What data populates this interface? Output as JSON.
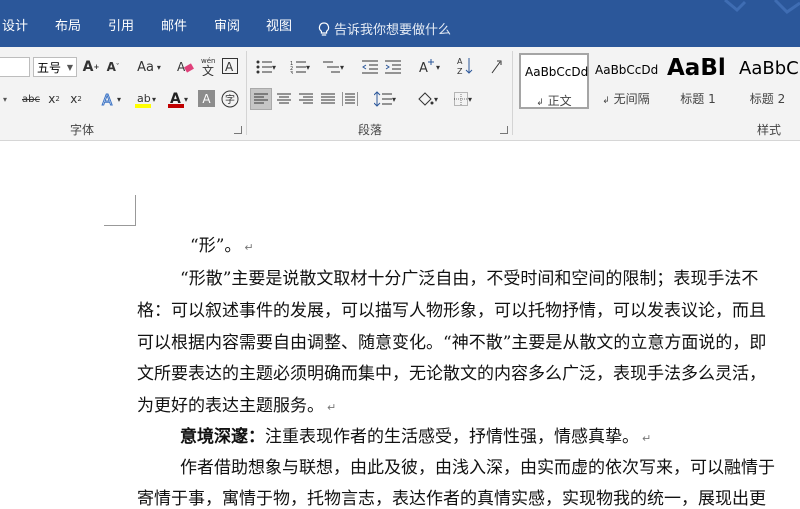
{
  "tabs": [
    {
      "label": "设计"
    },
    {
      "label": "布局"
    },
    {
      "label": "引用"
    },
    {
      "label": "邮件"
    },
    {
      "label": "审阅"
    },
    {
      "label": "视图"
    }
  ],
  "tell_me": {
    "placeholder": "告诉我你想要做什么"
  },
  "font": {
    "size": "五号"
  },
  "groups": {
    "font_label": "字体",
    "paragraph_label": "段落",
    "styles_label": "样式"
  },
  "styles": [
    {
      "preview": "AaBbCcDd",
      "name": "正文",
      "selected": true
    },
    {
      "preview": "AaBbCcDd",
      "name": "无间隔"
    },
    {
      "preview": "AaBl",
      "name": "标题 1"
    },
    {
      "preview": "AaBbC",
      "name": "标题 2"
    }
  ],
  "document": {
    "lines": [
      {
        "text": "“形”。",
        "mark": "↵"
      },
      {
        "text": "“形散”主要是说散文取材十分广泛自由，不受时间和空间的限制；表现手法不"
      },
      {
        "text": "格：可以叙述事件的发展，可以描写人物形象，可以托物抒情，可以发表议论，而且"
      },
      {
        "text": "可以根据内容需要自由调整、随意变化。“神不散”主要是从散文的立意方面说的，即"
      },
      {
        "text": "文所要表达的主题必须明确而集中，无论散文的内容多么广泛，表现手法多么灵活，"
      },
      {
        "text": "为更好的表达主题服务。",
        "mark": "↵"
      },
      {
        "bold": "意境深邃：",
        "text": "注重表现作者的生活感受，抒情性强，情感真挚。",
        "mark": "↵"
      },
      {
        "text": "作者借助想象与联想，由此及彼，由浅入深，由实而虚的依次写来，可以融情于"
      },
      {
        "text": "寄情于事，寓情于物，托物言志，表达作者的真情实感，实现物我的统一，展现出更"
      }
    ]
  },
  "colors": {
    "ribbon_blue": "#2b579a",
    "highlight": "#ffff00",
    "font_color": "#c00000"
  }
}
